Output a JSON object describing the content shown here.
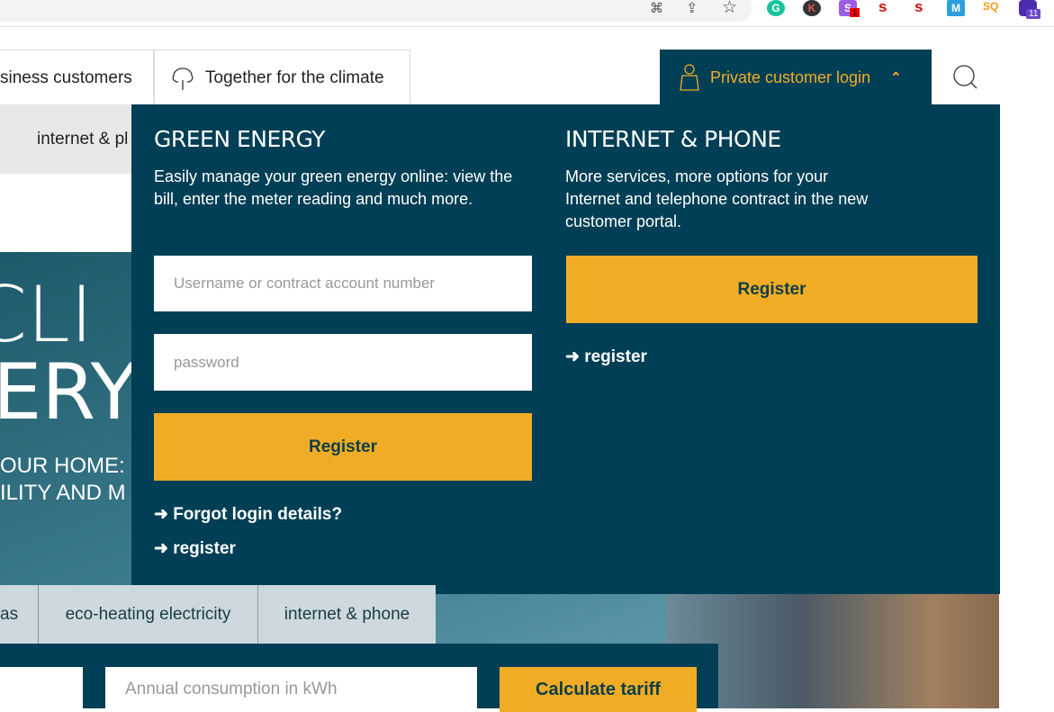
{
  "browser": {
    "extensions": [
      "translate-icon",
      "share-icon",
      "star-icon",
      "grammarly",
      "k",
      "s-badge",
      "s-red",
      "s-red",
      "m",
      "sq",
      "puzzle-badge"
    ],
    "badge_s": "1",
    "badge_ext": "11"
  },
  "header": {
    "tabs": [
      {
        "label": "siness customers"
      },
      {
        "label": "Together for the climate"
      }
    ],
    "login_label": "Private customer login"
  },
  "nav": {
    "item": "internet & pl"
  },
  "hero": {
    "line1": "CLI",
    "line2": "ERY",
    "sub1": "OUR HOME:",
    "sub2": "ILITY AND M"
  },
  "panel": {
    "green": {
      "title": "GREEN ENERGY",
      "desc": "Easily manage your green energy online: view the bill, enter the meter reading and much more.",
      "username_placeholder": "Username or contract account number",
      "password_placeholder": "password",
      "button": "Register",
      "forgot": "➜ Forgot login details?",
      "register": "➜ register"
    },
    "internet": {
      "title": "INTERNET & PHONE",
      "desc": "More services, more options for your Internet and telephone contract in the new customer portal.",
      "button": "Register",
      "register": "➜ register"
    }
  },
  "categories": [
    {
      "label": "as"
    },
    {
      "label": "eco-heating electricity"
    },
    {
      "label": "internet & phone"
    }
  ],
  "calculator": {
    "placeholder": "Annual consumption in kWh",
    "button": "Calculate tariff"
  },
  "colors": {
    "navy": "#003f55",
    "accent": "#f0ac25"
  }
}
